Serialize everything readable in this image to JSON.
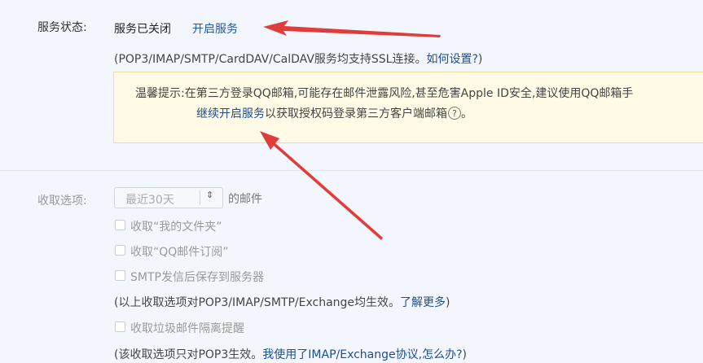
{
  "service": {
    "label": "服务状态:",
    "status": "服务已关闭",
    "enable_link": "开启服务",
    "protocols_note_prefix": "(POP3/IMAP/SMTP/CardDAV/CalDAV服务均支持SSL连接。",
    "howto_link": "如何设置?",
    "protocols_note_suffix": ")"
  },
  "notice": {
    "line1": "温馨提示:在第三方登录QQ邮箱,可能存在邮件泄露风险,甚至危害Apple ID安全,建议使用QQ邮箱手",
    "link": "继续开启服务",
    "line2_suffix": "以获取授权码登录第三方客户端邮箱",
    "help_icon_glyph": "?",
    "end_punct": "。"
  },
  "fetch": {
    "label": "收取选项:",
    "select_value": "最近30天",
    "select_suffix": "的邮件",
    "option_my_folders": "收取“我的文件夹”",
    "option_qq_subscriptions": "收取“QQ邮件订阅”",
    "option_smtp_save": "SMTP发信后保存到服务器",
    "note1_prefix": "(以上收取选项对POP3/IMAP/SMTP/Exchange均生效。",
    "note1_link": "了解更多",
    "note1_suffix": ")",
    "option_spam_isolation": "收取垃圾邮件隔离提醒",
    "note2_prefix": "(该收取选项只对POP3生效。",
    "note2_link": "我使用了IMAP/Exchange协议,怎么办?",
    "note2_suffix": ")"
  },
  "colors": {
    "link": "#1d5aa8",
    "annotation_arrow": "#e03c3c",
    "notice_background": "#fffbe6"
  }
}
